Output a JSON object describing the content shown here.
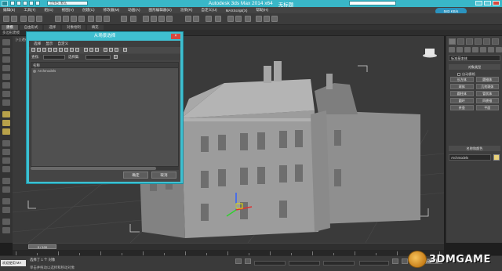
{
  "app": {
    "title_product": "Autodesk 3ds Max  2014 x64",
    "title_file": "无标题",
    "workspace_label": "工作台: 默认"
  },
  "menu": [
    "编辑(E)",
    "工具(T)",
    "组(G)",
    "视图(V)",
    "创建(C)",
    "修改器(M)",
    "动画(A)",
    "图形编辑器(D)",
    "渲染(R)",
    "自定义(U)",
    "MAXScript(X)",
    "帮助(H)"
  ],
  "net_badge": "583 KB/s",
  "ribbon": {
    "tabs": [
      "建模",
      "自由形式",
      "选择",
      "对象绘制",
      "填充"
    ],
    "active_tab": 0,
    "sub_label": "多边形建模"
  },
  "viewport": {
    "label": "[+] [透视] [真实]",
    "axis_colors": {
      "x": "#e03030",
      "y": "#30d030",
      "z": "#3060ff",
      "select": "#e8e000"
    }
  },
  "dialog": {
    "title": "从场景选择",
    "close_glyph": "×",
    "menus": [
      "选择",
      "显示",
      "自定义"
    ],
    "find_label": "查找:",
    "selection_set_label": "选择集:",
    "column_header": "名称",
    "items": [
      "Archmodels"
    ],
    "ok_label": "确定",
    "cancel_label": "取消"
  },
  "command_panel": {
    "object_type_select": "标准基本体",
    "object_type_header": "对象类型",
    "autogrid_label": "自动栅格",
    "buttons": [
      "长方体",
      "圆锥体",
      "球体",
      "几何球体",
      "圆柱体",
      "管状体",
      "圆环",
      "四棱锥",
      "茶壶",
      "平面"
    ],
    "name_color_header": "名称和颜色",
    "name_value": "Archmodels",
    "swatch_color": "#e9d27a"
  },
  "timeline": {
    "slider_label": "0 / 100",
    "ticks": [
      "0",
      "10",
      "20",
      "30",
      "40",
      "50",
      "60",
      "70",
      "80",
      "90",
      "100"
    ]
  },
  "status": {
    "maxscript_label": "欢迎使用 MA",
    "line1": "选择了 1 个 对象",
    "line2": "单击并拖动以选择和移动对象",
    "autokey_label": "自动关键点"
  },
  "watermark": {
    "text": "3DMGAME"
  }
}
